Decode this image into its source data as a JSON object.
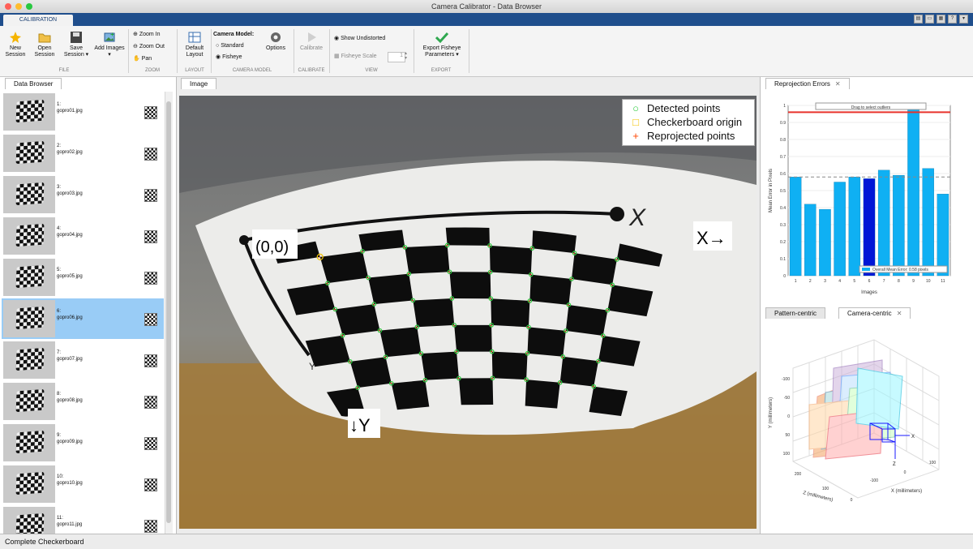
{
  "window": {
    "title": "Camera Calibrator - Data Browser"
  },
  "tabstrip": {
    "tab": "CALIBRATION"
  },
  "ribbon": {
    "file": {
      "new_session": "New Session",
      "open_session": "Open Session",
      "save_session": "Save Session ▾",
      "add_images": "Add Images ▾",
      "group": "FILE"
    },
    "zoom": {
      "zoom_in": "Zoom In",
      "zoom_out": "Zoom Out",
      "pan": "Pan",
      "group": "ZOOM"
    },
    "layout": {
      "default_layout": "Default Layout",
      "group": "LAYOUT"
    },
    "camera_model": {
      "label": "Camera Model:",
      "standard": "Standard",
      "fisheye": "Fisheye",
      "options": "Options",
      "group": "CAMERA MODEL"
    },
    "calibrate": {
      "calibrate": "Calibrate",
      "group": "CALIBRATE"
    },
    "view": {
      "show_undistorted": "Show Undistorted",
      "fisheye_scale": "Fisheye Scale",
      "scale_value": "1",
      "group": "VIEW"
    },
    "export": {
      "export_label": "Export Fisheye Parameters ▾",
      "group": "EXPORT"
    }
  },
  "data_browser": {
    "tab": "Data Browser",
    "items": [
      {
        "num": "1:",
        "file": "gopro01.jpg"
      },
      {
        "num": "2:",
        "file": "gopro02.jpg"
      },
      {
        "num": "3:",
        "file": "gopro03.jpg"
      },
      {
        "num": "4:",
        "file": "gopro04.jpg"
      },
      {
        "num": "5:",
        "file": "gopro05.jpg"
      },
      {
        "num": "6:",
        "file": "gopro06.jpg"
      },
      {
        "num": "7:",
        "file": "gopro07.jpg"
      },
      {
        "num": "8:",
        "file": "gopro08.jpg"
      },
      {
        "num": "9:",
        "file": "gopro09.jpg"
      },
      {
        "num": "10:",
        "file": "gopro10.jpg"
      },
      {
        "num": "11:",
        "file": "gopro11.jpg"
      }
    ],
    "selected_index": 5
  },
  "image_panel": {
    "tab": "Image",
    "labels": {
      "origin": "(0,0)",
      "x_arrow": "X→",
      "y_arrow": "↓Y",
      "x_axis": "X",
      "y_axis": "Y"
    },
    "legend": {
      "detected": "Detected points",
      "origin": "Checkerboard origin",
      "reprojected": "Reprojected points",
      "detected_color": "#2ecc40",
      "origin_color": "#f2c200",
      "reprojected_color": "#ff4500"
    }
  },
  "reprojection": {
    "tab": "Reprojection Errors",
    "hint": "Drag to select outliers",
    "legend": "Overall Mean Error: 0.58 pixels",
    "chart_data": {
      "type": "bar",
      "categories": [
        "1",
        "2",
        "3",
        "4",
        "5",
        "6",
        "7",
        "8",
        "9",
        "10",
        "11"
      ],
      "values": [
        0.58,
        0.42,
        0.39,
        0.55,
        0.58,
        0.57,
        0.62,
        0.59,
        0.98,
        0.63,
        0.48
      ],
      "highlight_index": 5,
      "mean": 0.58,
      "threshold": 0.96,
      "xlabel": "Images",
      "ylabel": "Mean Error in Pixels",
      "ylim": [
        0,
        1
      ],
      "yticks": [
        "0",
        "0.1",
        "0.2",
        "0.3",
        "0.4",
        "0.5",
        "0.6",
        "0.7",
        "0.8",
        "0.9",
        "1"
      ],
      "bar_color": "#0fb0f3",
      "highlight_color": "#0016d6"
    }
  },
  "extrinsics": {
    "tabs": [
      "Pattern-centric",
      "Camera-centric"
    ],
    "active_tab": "Camera-centric",
    "ylabel": "Y (millimeters)",
    "zlabel": "Z (millimeters)",
    "xlabel": "X (millimeters)",
    "yticks": [
      "-100",
      "-50",
      "0",
      "50",
      "100"
    ],
    "zticks": [
      "0",
      "100",
      "200"
    ],
    "xticks": [
      "-100",
      "0",
      "100"
    ]
  },
  "status": {
    "text": "Complete Checkerboard"
  }
}
